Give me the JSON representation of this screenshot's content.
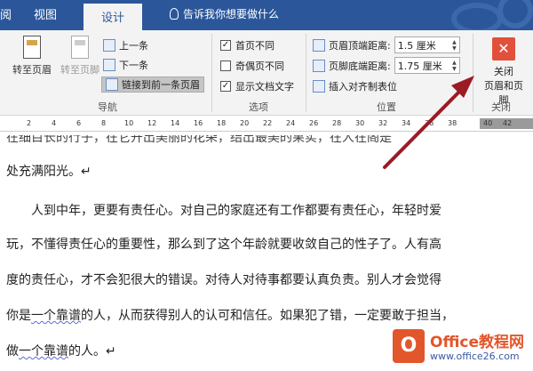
{
  "tabs": [
    {
      "label": "阅"
    },
    {
      "label": "视图"
    },
    {
      "label": "设计"
    }
  ],
  "tell_me": "告诉我你想要做什么",
  "ribbon": {
    "nav": {
      "goto_header": "转至页眉",
      "goto_footer": "转至页脚",
      "prev": "上一条",
      "next": "下一条",
      "link_prev": "链接到前一条页眉",
      "group": "导航"
    },
    "options": {
      "first_page": "首页不同",
      "odd_even": "奇偶页不同",
      "show_text": "显示文档文字",
      "first_checked": "✓",
      "show_checked": "✓",
      "group": "选项"
    },
    "position": {
      "header_top": "页眉顶端距离:",
      "header_top_value": "1.5 厘米",
      "footer_bottom": "页脚底端距离:",
      "footer_bottom_value": "1.75 厘米",
      "insert_align": "插入对齐制表位",
      "group": "位置"
    },
    "close": {
      "label_1": "关闭",
      "label_2": "页眉和页脚",
      "icon": "✕",
      "group": "关闭"
    }
  },
  "ruler": {
    "ticks": [
      "2",
      "4",
      "6",
      "8",
      "10",
      "12",
      "14",
      "16",
      "18",
      "20",
      "22",
      "24",
      "26",
      "28",
      "30",
      "32",
      "34",
      "36",
      "38",
      "40",
      "42"
    ]
  },
  "document": {
    "line_0": "在细目长的行子，在它开出美丽的花朵，结出最美的果实，在人在阁是",
    "line_1": "处充满阳光。↵",
    "line_2": "人到中年，更要有责任心。对自己的家庭还有工作都要有责任心，年轻时爱",
    "line_3": "玩，不懂得责任心的重要性，那么到了这个年龄就要收敛自己的性子了。人有高",
    "line_4": "度的责任心，才不会犯很大的错误。对待人对待事都要认真负责。别人才会觉得",
    "line_5a": "你是",
    "line_5b": "一个靠谱",
    "line_5c": "的人，从而获得别人的认可和信任。如果犯了错，一定要敢于担当，",
    "line_6a": "做",
    "line_6b": "一个靠谱",
    "line_6c": "的人。↵"
  },
  "watermark": {
    "logo": "O",
    "title": "Office教程网",
    "url": "www.office26.com"
  },
  "colors": {
    "accent": "#2b579a",
    "close": "#e1503a",
    "arrow": "#9b1b25"
  }
}
